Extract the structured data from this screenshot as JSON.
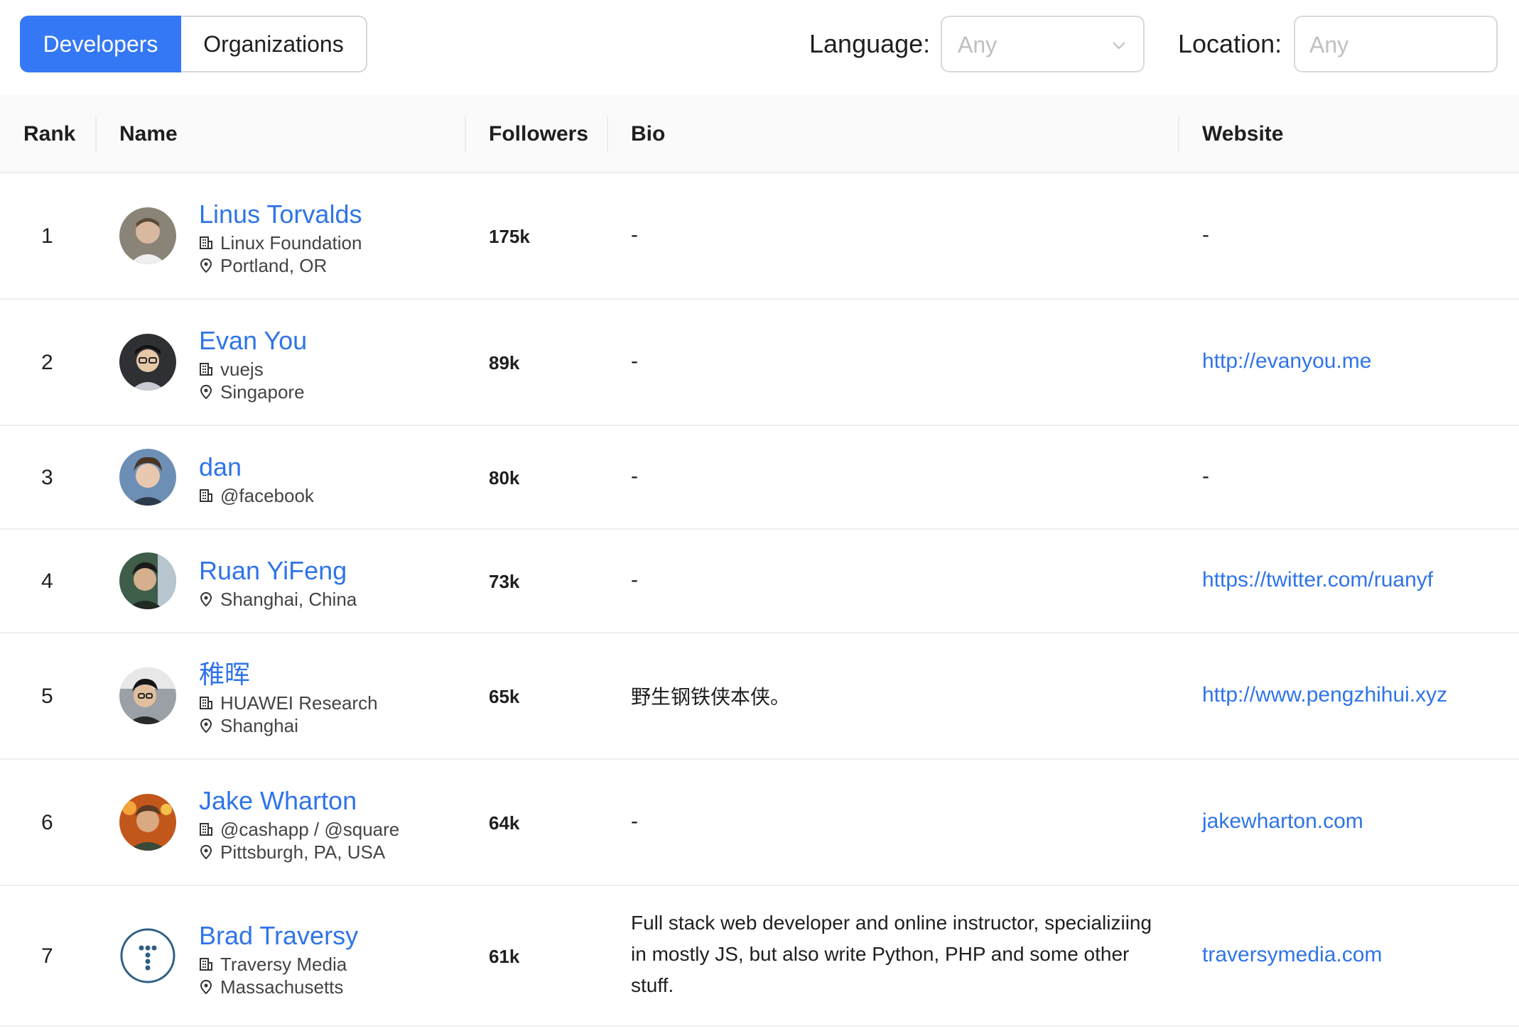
{
  "tabs": {
    "developers": "Developers",
    "organizations": "Organizations"
  },
  "filters": {
    "language_label": "Language:",
    "language_value": "Any",
    "location_label": "Location:",
    "location_placeholder": "Any"
  },
  "columns": {
    "rank": "Rank",
    "name": "Name",
    "followers": "Followers",
    "bio": "Bio",
    "website": "Website"
  },
  "icons": {
    "company": "building-icon",
    "location": "map-pin-icon",
    "select": "chevron-down-icon"
  },
  "colors": {
    "accent": "#3478f6",
    "link": "#2f74e8",
    "border": "#eeeeee"
  },
  "rows": [
    {
      "rank": "1",
      "name": "Linus Torvalds",
      "company": "Linux Foundation",
      "location": "Portland, OR",
      "followers": "175k",
      "bio": "-",
      "website": "-"
    },
    {
      "rank": "2",
      "name": "Evan You",
      "company": "vuejs",
      "location": "Singapore",
      "followers": "89k",
      "bio": "-",
      "website": "http://evanyou.me"
    },
    {
      "rank": "3",
      "name": "dan",
      "company": "@facebook",
      "followers": "80k",
      "bio": "-",
      "website": "-"
    },
    {
      "rank": "4",
      "name": "Ruan YiFeng",
      "location": "Shanghai, China",
      "followers": "73k",
      "bio": "-",
      "website": "https://twitter.com/ruanyf"
    },
    {
      "rank": "5",
      "name": "稚晖",
      "company": "HUAWEI Research",
      "location": "Shanghai",
      "followers": "65k",
      "bio": "野生钢铁侠本侠。",
      "website": "http://www.pengzhihui.xyz"
    },
    {
      "rank": "6",
      "name": "Jake Wharton",
      "company": "@cashapp / @square",
      "location": "Pittsburgh, PA, USA",
      "followers": "64k",
      "bio": "-",
      "website": "jakewharton.com"
    },
    {
      "rank": "7",
      "name": "Brad Traversy",
      "company": "Traversy Media",
      "location": "Massachusetts",
      "followers": "61k",
      "bio": "Full stack web developer and online instructor, specializiing in mostly JS, but also write Python, PHP and some other stuff.",
      "website": "traversymedia.com"
    }
  ]
}
